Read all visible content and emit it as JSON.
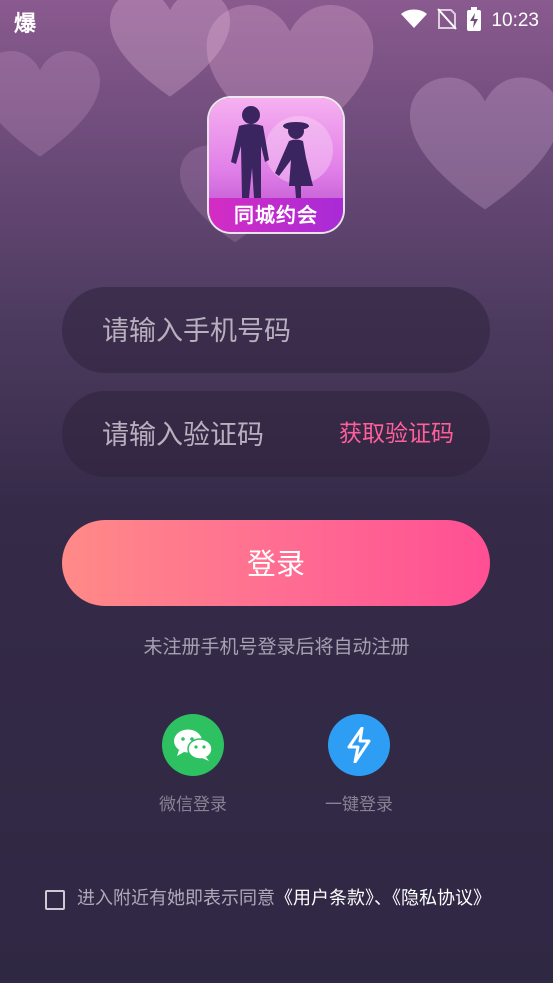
{
  "status_bar": {
    "left_glyph": "爆",
    "time": "10:23",
    "icons": [
      "wifi-icon",
      "no-sim-icon",
      "battery-charging-icon"
    ]
  },
  "logo": {
    "label": "同城约会"
  },
  "phone_field": {
    "value": "",
    "placeholder": "请输入手机号码"
  },
  "code_field": {
    "value": "",
    "placeholder": "请输入验证码",
    "get_code_label": "获取验证码"
  },
  "login_button": {
    "label": "登录"
  },
  "hint": "未注册手机号登录后将自动注册",
  "social": {
    "wechat_label": "微信登录",
    "onekey_label": "一键登录"
  },
  "agreement": {
    "prefix": "进入附近有她即表示同意",
    "terms": "《用户条款》",
    "separator": "、",
    "privacy": "《隐私协议》",
    "checked": false
  },
  "colors": {
    "accent": "#ff5f9a",
    "button_start": "#ff8a87",
    "button_end": "#ff4f93",
    "wechat": "#2dc162",
    "onekey": "#2e9ef5"
  }
}
